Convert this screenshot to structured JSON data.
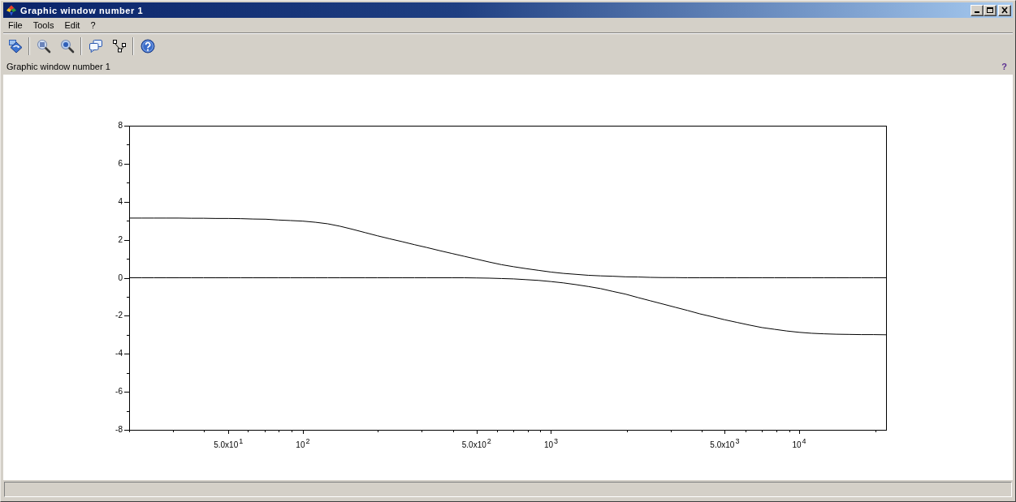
{
  "window": {
    "title": "Graphic window number 1"
  },
  "menu": [
    "File",
    "Tools",
    "Edit",
    "?"
  ],
  "info_bar": {
    "text": "Graphic window number 1",
    "help_mark": "?"
  },
  "plot": {
    "chart_data": {
      "type": "line",
      "categories": [
        null,
        null,
        null,
        null,
        null,
        null,
        null,
        null,
        "5.0x10$^{1}$",
        null,
        null,
        null,
        null,
        null,
        "10$^{2}$",
        null,
        null,
        null,
        null,
        null,
        null,
        null,
        null,
        null,
        null,
        null,
        null,
        null,
        "5.0x10$^{2}$",
        null,
        null,
        null,
        null,
        null,
        "10$^{3}$",
        null,
        null,
        null,
        null,
        null,
        null,
        null,
        null,
        null,
        null,
        null,
        null,
        null,
        "5.0x10$^{3}$",
        null,
        null,
        null,
        null,
        null,
        "10$^{4}$",
        null,
        null,
        null,
        null,
        null,
        null,
        null
      ],
      "series": [
        {
          "color": "#000000",
          "values": [
            3.14,
            3.14,
            3.14,
            3.14,
            3.14,
            3.13,
            3.13,
            3.12,
            3.12,
            3.11,
            3.09,
            3.08,
            3.04,
            3.01,
            2.98,
            2.92,
            2.84,
            2.71,
            2.55,
            2.38,
            2.21,
            2.05,
            1.9,
            1.74,
            1.59,
            1.43,
            1.28,
            1.13,
            0.98,
            0.83,
            0.69,
            0.58,
            0.48,
            0.39,
            0.3,
            0.23,
            0.18,
            0.13,
            0.1,
            0.08,
            0.05,
            0.04,
            0.02,
            0.01,
            0.01,
            0,
            0,
            0,
            0,
            0,
            0,
            0,
            0,
            0,
            0,
            0,
            0,
            0,
            0,
            0,
            0,
            0
          ]
        },
        {
          "color": "#000000",
          "values": [
            0,
            0,
            0,
            0,
            0,
            0,
            0,
            0,
            0,
            0,
            0,
            0,
            0,
            0,
            0,
            0,
            0,
            0,
            0,
            0,
            0,
            0,
            0,
            0,
            0,
            0,
            0,
            0,
            -0.01,
            -0.02,
            -0.04,
            -0.06,
            -0.1,
            -0.14,
            -0.2,
            -0.27,
            -0.36,
            -0.46,
            -0.57,
            -0.72,
            -0.86,
            -1.04,
            -1.21,
            -1.38,
            -1.55,
            -1.72,
            -1.9,
            -2.05,
            -2.21,
            -2.35,
            -2.49,
            -2.62,
            -2.71,
            -2.8,
            -2.87,
            -2.92,
            -2.95,
            -2.97,
            -2.98,
            -2.99,
            -2.99,
            -3.0
          ]
        }
      ],
      "ylim": [
        -8,
        8
      ],
      "yticks": [
        -8,
        -6,
        -4,
        -2,
        0,
        2,
        4,
        6,
        8
      ]
    }
  }
}
